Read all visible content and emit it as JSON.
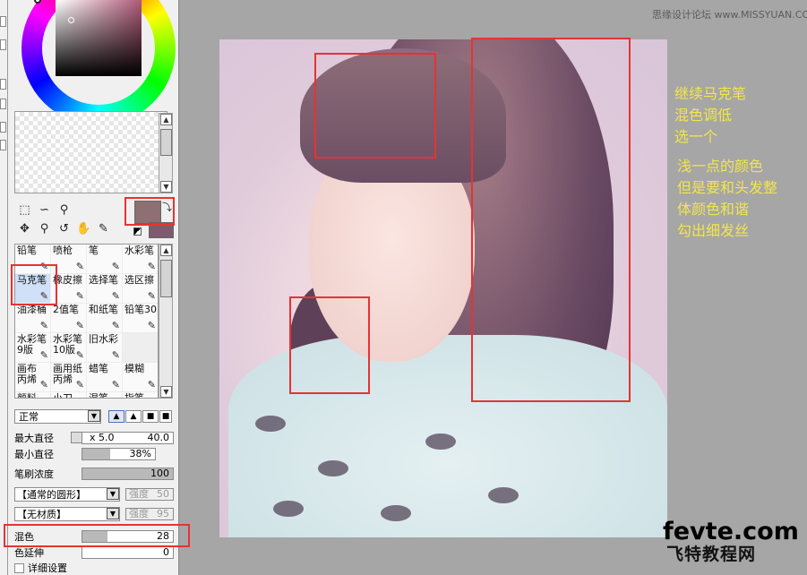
{
  "watermark": "思缘设计论坛 www.MISSYUAN.COM",
  "tools": {
    "fg_color": "#8e6f72",
    "bg_color": "#7f5a6e"
  },
  "brushes": [
    {
      "label": "铅笔",
      "icon": "pencil-icon"
    },
    {
      "label": "喷枪",
      "icon": "airbrush-icon"
    },
    {
      "label": "笔",
      "icon": "pen-icon"
    },
    {
      "label": "水彩笔",
      "icon": "watercolor-icon"
    },
    {
      "label": "马克笔",
      "icon": "marker-icon",
      "selected": true
    },
    {
      "label": "橡皮擦",
      "icon": "eraser-icon"
    },
    {
      "label": "选择笔",
      "icon": "select-pen-icon"
    },
    {
      "label": "选区擦",
      "icon": "select-eraser-icon"
    },
    {
      "label": "油漆桶",
      "icon": "bucket-icon"
    },
    {
      "label": "2值笔",
      "icon": "binary-pen-icon"
    },
    {
      "label": "和纸笔",
      "icon": "washi-pen-icon"
    },
    {
      "label": "铅笔30",
      "icon": "pencil30-icon"
    },
    {
      "label": "水彩笔\n9版",
      "icon": "watercolor9-icon"
    },
    {
      "label": "水彩笔\n10版",
      "icon": "watercolor10-icon"
    },
    {
      "label": "旧水彩",
      "icon": "old-watercolor-icon"
    },
    {
      "label": "",
      "icon": ""
    },
    {
      "label": "画布\n丙烯",
      "icon": "canvas-acrylic-icon"
    },
    {
      "label": "画用纸\n丙烯",
      "icon": "paper-acrylic-icon"
    },
    {
      "label": "蜡笔",
      "icon": "crayon-icon"
    },
    {
      "label": "模糊",
      "icon": "blur-icon"
    },
    {
      "label": "颜料",
      "icon": "paint-icon"
    },
    {
      "label": "小刀",
      "icon": "knife-icon"
    },
    {
      "label": "混笔",
      "icon": "blend-pen-icon"
    },
    {
      "label": "指笔",
      "icon": "finger-icon"
    }
  ],
  "blend_mode": "正常",
  "max_size": {
    "label": "最大直径",
    "multiplier": "x 5.0",
    "value": "40.0"
  },
  "min_size": {
    "label": "最小直径",
    "value": "38%",
    "level": 0.38
  },
  "density": {
    "label": "笔刷浓度",
    "value": "100",
    "level": 1.0
  },
  "shape": {
    "label": "【通常的圆形】",
    "strength_label": "强度",
    "strength": "50"
  },
  "texture": {
    "label": "【无材质】",
    "strength_label": "强度",
    "strength": "95"
  },
  "blending": {
    "label": "混色",
    "value": "28",
    "level": 0.28
  },
  "persistence": {
    "label": "色延伸",
    "value": "0",
    "level": 0.0
  },
  "advanced": {
    "label": "详细设置"
  },
  "notes": {
    "note1": "继续马克笔\n混色调低\n选一个",
    "note2": "浅一点的颜色\n但是要和头发整\n体颜色和谐\n勾出细发丝"
  },
  "logo": {
    "top": "fevte.com",
    "bottom": "飞特教程网"
  }
}
